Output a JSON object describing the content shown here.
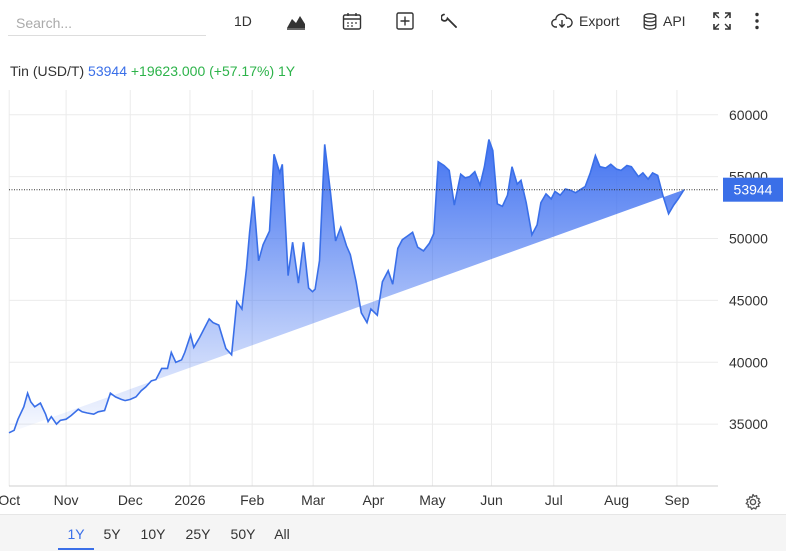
{
  "toolbar": {
    "search_placeholder": "Search...",
    "interval_label": "1D",
    "export_label": "Export",
    "api_label": "API"
  },
  "legend": {
    "name": "Tin (USD/T)",
    "value": "53944",
    "change": "+19623.000 (+57.17%)",
    "period": "1Y"
  },
  "periods": [
    "1Y",
    "5Y",
    "10Y",
    "25Y",
    "50Y",
    "All"
  ],
  "active_period": "1Y",
  "colors": {
    "line": "#3a6fe8",
    "fill_top": "#3d6ff0",
    "change": "#2db34a",
    "grid": "#ebebeb"
  },
  "chart_data": {
    "type": "area",
    "title": "",
    "ylim": [
      30000,
      62000
    ],
    "y_ticks": [
      35000,
      40000,
      45000,
      50000,
      55000,
      60000
    ],
    "x_labels": [
      "Oct",
      "Nov",
      "Dec",
      "2026",
      "Feb",
      "Mar",
      "Apr",
      "May",
      "Jun",
      "Jul",
      "Aug",
      "Sep"
    ],
    "x_label_positions": [
      0.03,
      8.9,
      18.9,
      28.2,
      37.9,
      47.4,
      56.8,
      66.0,
      75.2,
      84.9,
      94.7,
      104.1
    ],
    "last_value": 53944,
    "x": [
      0,
      0.8,
      1.4,
      2.3,
      2.9,
      3.4,
      4.0,
      4.9,
      5.7,
      6.1,
      6.6,
      7.4,
      8.0,
      8.9,
      9.7,
      10.8,
      11.4,
      12.2,
      13.2,
      13.9,
      14.9,
      15.8,
      16.6,
      17.5,
      18.1,
      18.9,
      19.8,
      20.6,
      21.3,
      22.2,
      22.9,
      23.8,
      24.7,
      25.3,
      26.0,
      26.9,
      27.4,
      28.3,
      28.8,
      29.7,
      30.4,
      31.2,
      31.8,
      32.7,
      33.8,
      34.7,
      35.5,
      36.3,
      37.0,
      37.5,
      38.1,
      38.9,
      39.6,
      40.6,
      41.3,
      42.2,
      42.6,
      43.5,
      44.2,
      45.1,
      45.9,
      46.7,
      47.3,
      47.7,
      48.4,
      49.2,
      50.1,
      50.9,
      51.7,
      52.6,
      53.2,
      54.1,
      54.9,
      55.8,
      56.4,
      57.4,
      58.2,
      59.1,
      59.8,
      60.6,
      61.3,
      62.1,
      62.9,
      63.7,
      64.6,
      65.5,
      66.2,
      66.9,
      67.8,
      68.6,
      69.4,
      70.4,
      71.1,
      71.8,
      72.6,
      73.4,
      74.1,
      74.8,
      75.4,
      76.1,
      76.9,
      77.7,
      78.4,
      79.2,
      79.8,
      80.6,
      81.5,
      82.3,
      82.9,
      83.7,
      84.5,
      85.1,
      85.9,
      86.7,
      87.5,
      88.3,
      88.9,
      89.8,
      90.6,
      91.4,
      92.1,
      93.0,
      93.8,
      94.7,
      95.4,
      96.3,
      97.0,
      98.1,
      98.8,
      99.6,
      100.3,
      101.1,
      101.9,
      102.8,
      103.6,
      104.3,
      105.2,
      106.1,
      106.9,
      107.6,
      108.4,
      109.3
    ],
    "y": [
      34300,
      34500,
      35400,
      36400,
      37500,
      36800,
      36400,
      36700,
      35800,
      35200,
      35600,
      35000,
      35300,
      35400,
      35700,
      36200,
      36000,
      35900,
      35800,
      36000,
      36100,
      37500,
      37200,
      37000,
      36900,
      37000,
      37200,
      37700,
      38000,
      38500,
      38600,
      39500,
      39500,
      40800,
      40000,
      40200,
      40800,
      42200,
      41200,
      42000,
      42700,
      43500,
      43200,
      43000,
      41100,
      40600,
      44900,
      44300,
      47500,
      50500,
      53400,
      48200,
      49500,
      50600,
      56800,
      55300,
      56000,
      47000,
      49700,
      46400,
      49700,
      46000,
      45700,
      45900,
      48200,
      57600,
      53700,
      49800,
      50900,
      49400,
      48700,
      46500,
      44000,
      43200,
      44300,
      43800,
      46500,
      47400,
      46300,
      49200,
      49900,
      50200,
      50500,
      49300,
      49000,
      49600,
      50400,
      56200,
      55900,
      55500,
      52700,
      55200,
      54900,
      55000,
      55400,
      54300,
      55800,
      58000,
      57100,
      52800,
      52600,
      53500,
      55800,
      54400,
      54700,
      52900,
      50300,
      51100,
      52900,
      53600,
      53200,
      53800,
      53500,
      54000,
      53900,
      53700,
      53900,
      54200,
      55300,
      56700,
      55800,
      55700,
      56000,
      55600,
      55500,
      55900,
      55800,
      55000,
      55300,
      54800,
      55300,
      55100,
      53500,
      52000,
      52700,
      53200,
      53944
    ],
    "x_extent": [
      0,
      110.5
    ]
  }
}
